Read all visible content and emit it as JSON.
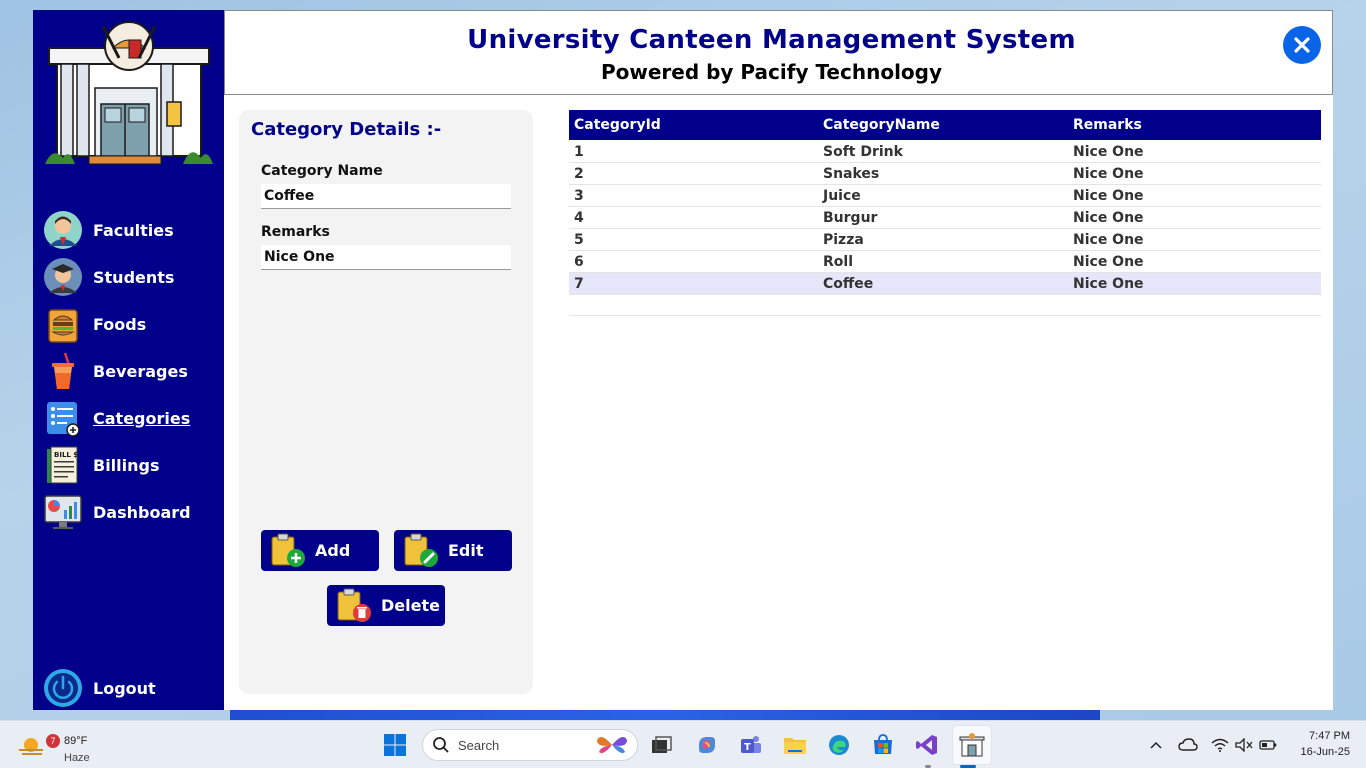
{
  "app": {
    "title": "University Canteen Management System",
    "subtitle": "Powered by Pacify Technology",
    "colors": {
      "primary": "#00008b",
      "close": "#0a64e8",
      "panel": "#f3f3f3",
      "selected_row": "#e6e6fa"
    }
  },
  "sidebar": {
    "items": [
      {
        "label": "Faculties",
        "icon": "faculty-icon"
      },
      {
        "label": "Students",
        "icon": "student-icon"
      },
      {
        "label": "Foods",
        "icon": "food-icon"
      },
      {
        "label": "Beverages",
        "icon": "beverage-icon"
      },
      {
        "label": "Categories",
        "icon": "categories-icon",
        "active": true
      },
      {
        "label": "Billings",
        "icon": "bill-icon"
      },
      {
        "label": "Dashboard",
        "icon": "dashboard-icon"
      }
    ],
    "logout": {
      "label": "Logout",
      "icon": "power-icon"
    }
  },
  "details": {
    "title": "Category Details :-",
    "category_name_label": "Category Name",
    "category_name_value": "Coffee",
    "remarks_label": "Remarks",
    "remarks_value": "Nice One",
    "buttons": {
      "add": "Add",
      "edit": "Edit",
      "delete": "Delete"
    }
  },
  "grid": {
    "columns": [
      "CategoryId",
      "CategoryName",
      "Remarks"
    ],
    "rows": [
      [
        "1",
        "Soft Drink",
        "Nice One"
      ],
      [
        "2",
        "Snakes",
        "Nice One"
      ],
      [
        "3",
        "Juice",
        "Nice One"
      ],
      [
        "4",
        "Burgur",
        "Nice One"
      ],
      [
        "5",
        "Pizza",
        "Nice One"
      ],
      [
        "6",
        "Roll",
        "Nice One"
      ],
      [
        "7",
        "Coffee",
        "Nice One"
      ]
    ],
    "selected_row": 7
  },
  "taskbar": {
    "weather_badge": "7",
    "temperature": "89°F",
    "condition": "Haze",
    "search_placeholder": "Search",
    "time": "7:47 PM",
    "date": "16-Jun-25"
  }
}
